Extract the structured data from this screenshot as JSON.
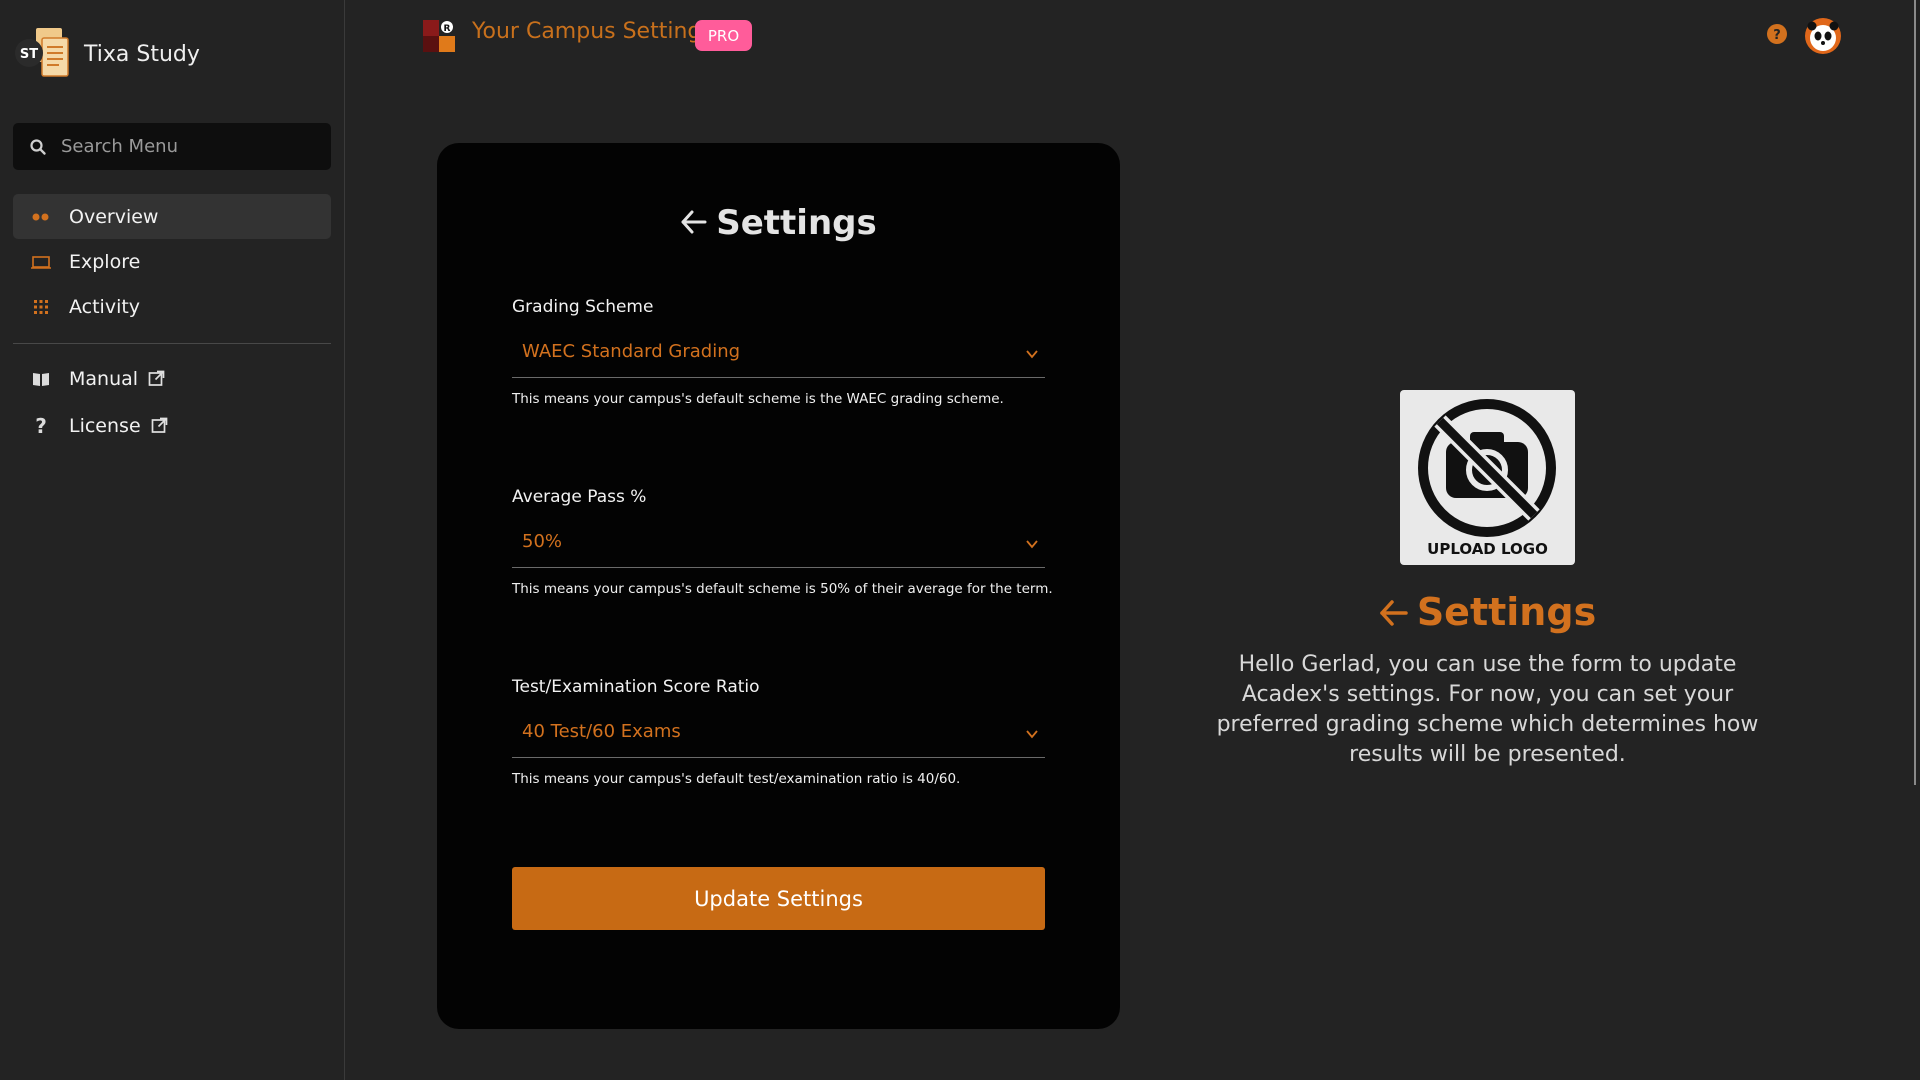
{
  "sidebar": {
    "brand_initials": "ST",
    "brand_name": "Tixa Study",
    "search_placeholder": "Search Menu",
    "nav_items": [
      {
        "label": "Overview",
        "icon": "dots-icon",
        "active": true
      },
      {
        "label": "Explore",
        "icon": "monitor-icon",
        "active": false
      },
      {
        "label": "Activity",
        "icon": "grid-icon",
        "active": false
      }
    ],
    "links": [
      {
        "label": "Manual",
        "icon": "book-icon"
      },
      {
        "label": "License",
        "icon": "question-icon"
      }
    ]
  },
  "header": {
    "title": "Your Campus Settings",
    "badge": "PRO"
  },
  "form": {
    "title": "Settings",
    "fields": [
      {
        "label": "Grading Scheme",
        "value": "WAEC Standard Grading",
        "help": "This means your campus's default scheme is the WAEC grading scheme."
      },
      {
        "label": "Average Pass %",
        "value": "50%",
        "help": "This means your campus's default scheme is 50% of their average for the term."
      },
      {
        "label": "Test/Examination Score Ratio",
        "value": "40 Test/60 Exams",
        "help": "This means your campus's default test/examination ratio is 40/60."
      }
    ],
    "submit_label": "Update Settings"
  },
  "info": {
    "upload_label": "UPLOAD LOGO",
    "title": "Settings",
    "text": "Hello Gerlad, you can use the form to update Acadex's settings. For now, you can set your preferred grading scheme which determines how results will be presented."
  },
  "colors": {
    "accent": "#c76a14",
    "accent_text": "#d2711e",
    "badge": "#ff5c9a",
    "background": "#232323",
    "card": "#030303"
  }
}
